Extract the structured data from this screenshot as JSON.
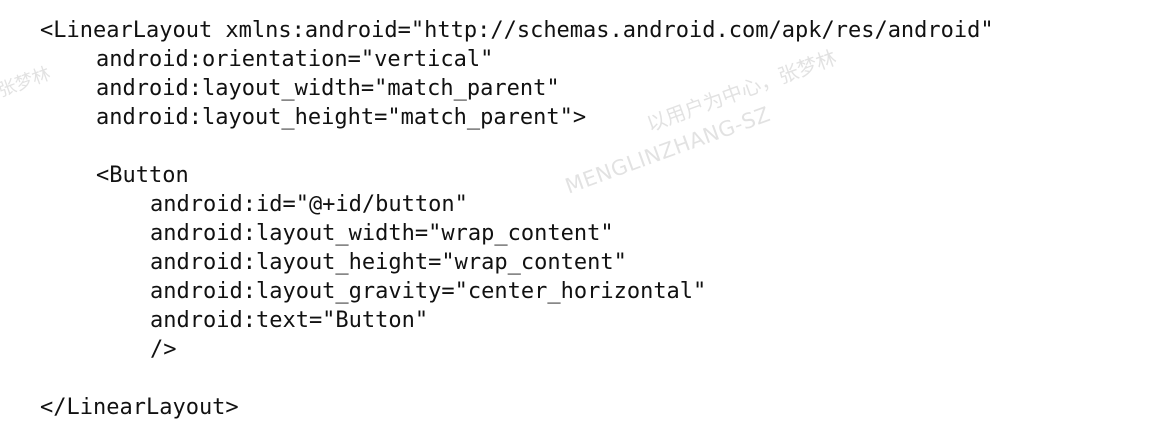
{
  "code_lines": [
    "<LinearLayout xmlns:android=\"http://schemas.android.com/apk/res/android\"",
    "android:orientation=\"vertical\"",
    "android:layout_width=\"match_parent\"",
    "android:layout_height=\"match_parent\">",
    "",
    "<Button",
    "android:id=\"@+id/button\"",
    "android:layout_width=\"wrap_content\"",
    "android:layout_height=\"wrap_content\"",
    "android:layout_gravity=\"center_horizontal\"",
    "android:text=\"Button\"",
    "/>",
    "",
    "</LinearLayout>"
  ],
  "watermark": {
    "left_fragment": "张梦林",
    "chinese": "以用户为中心，张梦林",
    "english": "MENGLINZHANG-SZ"
  }
}
